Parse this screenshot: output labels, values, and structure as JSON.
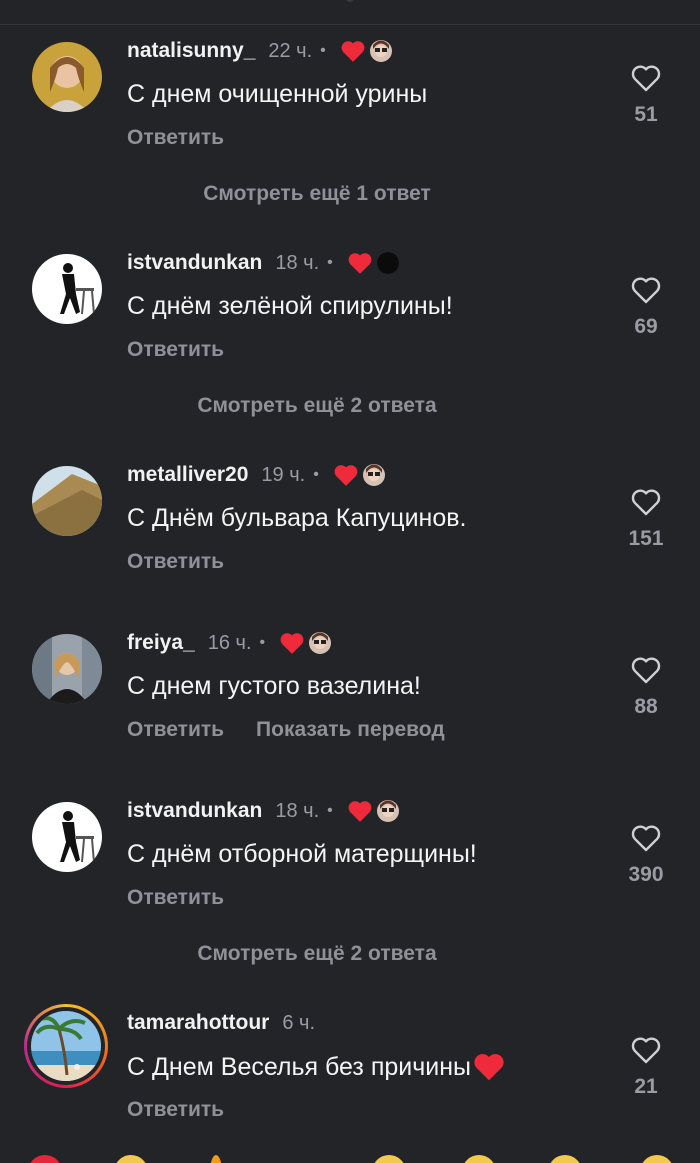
{
  "colors": {
    "background": "#232428",
    "heart_red": "#ee2a3b",
    "muted": "#8f9197"
  },
  "comments": [
    {
      "username": "natalisunny_",
      "time": "22 ч.",
      "dot": "•",
      "text": "С днем очищенной урины",
      "reply": "Ответить",
      "likes": "51",
      "badges": [
        "heart-icon",
        "author-avatar"
      ]
    },
    {
      "username": "istvandunkan",
      "time": "18 ч.",
      "dot": "•",
      "text": "С днём зелёной спирулины!",
      "reply": "Ответить",
      "likes": "69",
      "badges": [
        "heart-icon",
        "black-circle"
      ]
    },
    {
      "username": "metalliver20",
      "time": "19 ч.",
      "dot": "•",
      "text": "С Днём бульвара Капуцинов.",
      "reply": "Ответить",
      "likes": "151",
      "badges": [
        "heart-icon",
        "author-avatar"
      ]
    },
    {
      "username": "freiya_",
      "time": "16 ч.",
      "dot": "•",
      "text": "С днем густого вазелина!",
      "reply": "Ответить",
      "translate": "Показать перевод",
      "likes": "88",
      "badges": [
        "heart-icon",
        "author-avatar"
      ]
    },
    {
      "username": "istvandunkan",
      "time": "18 ч.",
      "dot": "•",
      "text": "С днём отборной матерщины!",
      "reply": "Ответить",
      "likes": "390",
      "badges": [
        "heart-icon",
        "author-avatar"
      ]
    },
    {
      "username": "tamarahottour",
      "time": "6 ч.",
      "text": "С Днем Веселья без причины",
      "reply": "Ответить",
      "likes": "21",
      "badges": []
    }
  ],
  "view_more": [
    "Смотреть ещё 1 ответ",
    "Смотреть ещё 2 ответа",
    "Смотреть ещё 2 ответа"
  ]
}
